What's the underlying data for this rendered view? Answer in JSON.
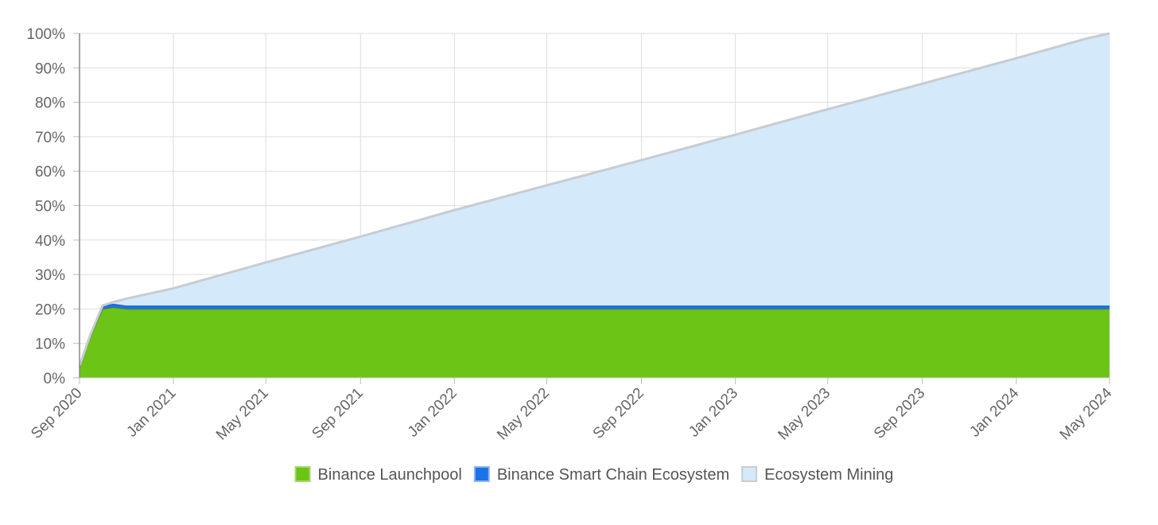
{
  "chart_data": {
    "type": "area",
    "stacked": true,
    "title": "",
    "xlabel": "",
    "ylabel": "",
    "x_axis": {
      "type": "date",
      "range": [
        "2020-09-01",
        "2024-05-01"
      ],
      "tick_labels": [
        "Sep 2020",
        "Jan 2021",
        "May 2021",
        "Sep 2021",
        "Jan 2022",
        "May 2022",
        "Sep 2022",
        "Jan 2023",
        "May 2023",
        "Sep 2023",
        "Jan 2024",
        "May 2024"
      ]
    },
    "y_axis": {
      "range": [
        0,
        100
      ],
      "unit": "%",
      "tick_labels": [
        "0%",
        "10%",
        "20%",
        "30%",
        "40%",
        "50%",
        "60%",
        "70%",
        "80%",
        "90%",
        "100%"
      ]
    },
    "grid": true,
    "legend_position": "bottom",
    "series": [
      {
        "name": "Binance Launchpool",
        "color": "#6cc417",
        "points": [
          [
            "2020-09-01",
            3
          ],
          [
            "2020-09-15",
            12
          ],
          [
            "2020-10-01",
            20
          ],
          [
            "2020-10-15",
            20.5
          ],
          [
            "2020-11-01",
            20
          ],
          [
            "2021-01-01",
            20
          ],
          [
            "2022-01-01",
            20
          ],
          [
            "2023-01-01",
            20
          ],
          [
            "2024-01-01",
            20
          ],
          [
            "2024-05-01",
            20
          ]
        ]
      },
      {
        "name": "Binance Smart Chain Ecosystem",
        "color": "#1a73e8",
        "points": [
          [
            "2020-09-01",
            0.5
          ],
          [
            "2020-09-15",
            0.5
          ],
          [
            "2020-10-01",
            1
          ],
          [
            "2020-10-15",
            1
          ],
          [
            "2020-11-01",
            1
          ],
          [
            "2021-01-01",
            1
          ],
          [
            "2022-01-01",
            1
          ],
          [
            "2023-01-01",
            1
          ],
          [
            "2024-01-01",
            1
          ],
          [
            "2024-05-01",
            1
          ]
        ]
      },
      {
        "name": "Ecosystem Mining",
        "color": "#d4e9fa",
        "points": [
          [
            "2020-09-01",
            0
          ],
          [
            "2020-09-15",
            0
          ],
          [
            "2020-10-01",
            0
          ],
          [
            "2020-10-15",
            0.5
          ],
          [
            "2020-11-01",
            2
          ],
          [
            "2021-01-01",
            5
          ],
          [
            "2021-05-01",
            12.5
          ],
          [
            "2021-09-01",
            20
          ],
          [
            "2022-01-01",
            27.7
          ],
          [
            "2022-05-01",
            34.9
          ],
          [
            "2022-09-01",
            42.2
          ],
          [
            "2023-01-01",
            49.6
          ],
          [
            "2023-05-01",
            57
          ],
          [
            "2023-09-01",
            64.4
          ],
          [
            "2024-01-01",
            71.8
          ],
          [
            "2024-04-01",
            77.5
          ],
          [
            "2024-05-01",
            79
          ]
        ]
      }
    ]
  },
  "legend_items": [
    {
      "label": "Binance Launchpool",
      "swatch": "#6cc417",
      "border": "#a4d96c"
    },
    {
      "label": "Binance Smart Chain Ecosystem",
      "swatch": "#1a73e8",
      "border": "#8cb6f0"
    },
    {
      "label": "Ecosystem Mining",
      "swatch": "#d4e9fa",
      "border": "#c9cdd1"
    }
  ]
}
